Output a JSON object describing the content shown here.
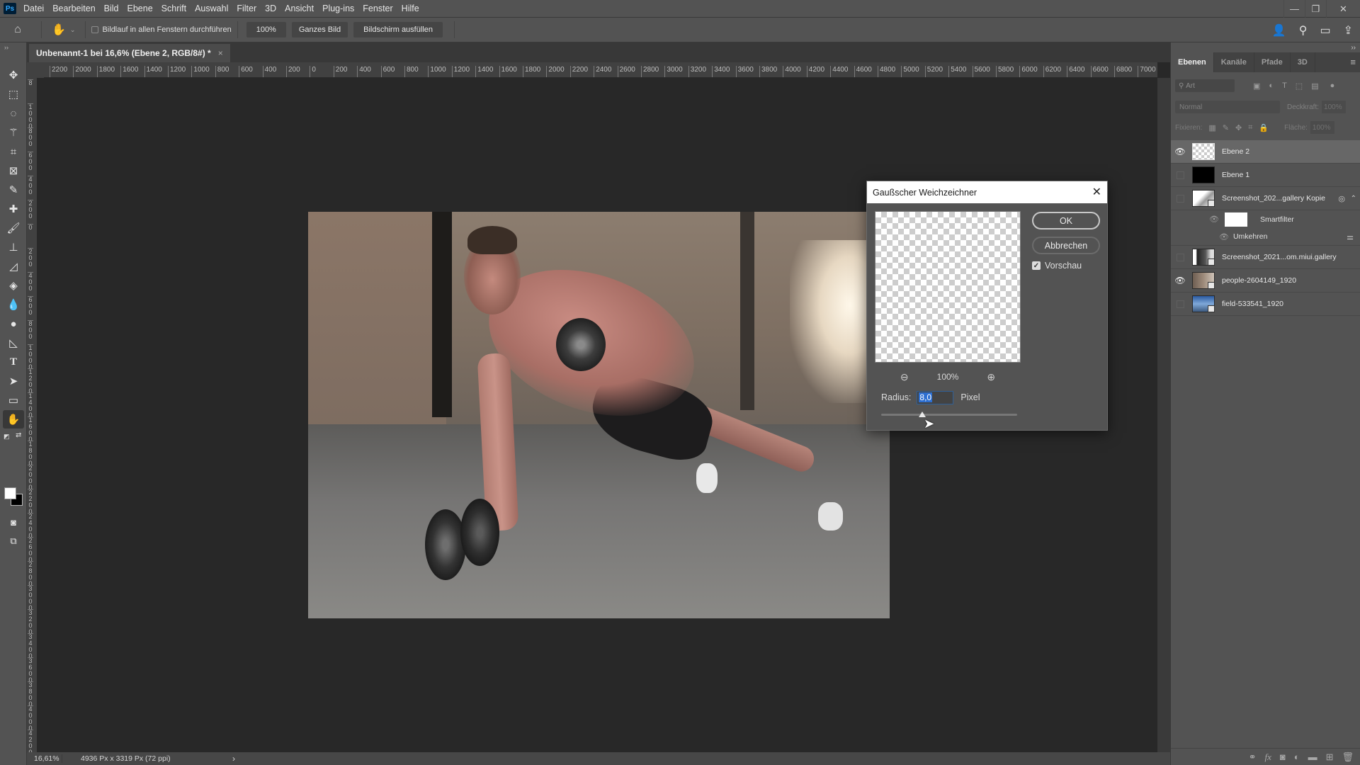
{
  "app": {
    "logo": "Ps"
  },
  "menu": [
    "Datei",
    "Bearbeiten",
    "Bild",
    "Ebene",
    "Schrift",
    "Auswahl",
    "Filter",
    "3D",
    "Ansicht",
    "Plug-ins",
    "Fenster",
    "Hilfe"
  ],
  "window_controls": {
    "minimize": "—",
    "restore": "❐",
    "close": "✕"
  },
  "options_bar": {
    "scroll_all_windows_label": "Bildlauf in allen Fenstern durchführen",
    "scroll_all_windows_checked": false,
    "zoom_100": "100%",
    "fit_screen": "Ganzes Bild",
    "fill_screen": "Bildschirm ausfüllen"
  },
  "document": {
    "tab_title": "Unbenannt-1 bei 16,6% (Ebene 2, RGB/8#) *",
    "tab_close": "×"
  },
  "rulers": {
    "horizontal": [
      "2200",
      "2000",
      "1800",
      "1600",
      "1400",
      "1200",
      "1000",
      "800",
      "600",
      "400",
      "200",
      "0",
      "200",
      "400",
      "600",
      "800",
      "1000",
      "1200",
      "1400",
      "1600",
      "1800",
      "2000",
      "2200",
      "2400",
      "2600",
      "2800",
      "3000",
      "3200",
      "3400",
      "3600",
      "3800",
      "4000",
      "4200",
      "4400",
      "4600",
      "4800",
      "5000",
      "5200",
      "5400",
      "5600",
      "5800",
      "6000",
      "6200",
      "6400",
      "6600",
      "6800",
      "7000"
    ],
    "vertical": [
      "8",
      "1000",
      "800",
      "600",
      "400",
      "200",
      "0",
      "200",
      "400",
      "600",
      "800",
      "1000",
      "1200",
      "1400",
      "1600",
      "1800",
      "2000",
      "2200",
      "2400",
      "2600",
      "2800",
      "3000",
      "3200",
      "3400",
      "3600",
      "3800",
      "4000",
      "4200"
    ]
  },
  "dialog": {
    "title": "Gaußscher Weichzeichner",
    "close": "✕",
    "ok_label": "OK",
    "cancel_label": "Abbrechen",
    "preview_label": "Vorschau",
    "preview_checked": true,
    "zoom_level": "100%",
    "radius_label": "Radius:",
    "radius_value": "8,0",
    "radius_unit": "Pixel",
    "radius_slider_fraction": 0.3
  },
  "layers_panel": {
    "tabs": [
      "Ebenen",
      "Kanäle",
      "Pfade",
      "3D"
    ],
    "active_tab": "Ebenen",
    "filter_placeholder": "Art",
    "blend_mode": "Normal",
    "opacity_label": "Deckkraft:",
    "opacity_value": "100%",
    "lock_label": "Fixieren:",
    "fill_label": "Fläche:",
    "fill_value": "100%",
    "layers": [
      {
        "name": "Ebene 2",
        "visible": true,
        "selected": true,
        "thumb": "transparent"
      },
      {
        "name": "Ebene 1",
        "visible": false,
        "selected": false,
        "thumb": "black"
      },
      {
        "name": "Screenshot_202...gallery Kopie",
        "visible": false,
        "selected": false,
        "thumb": "smart-white"
      },
      {
        "name": "Screenshot_2021...om.miui.gallery",
        "visible": false,
        "selected": false,
        "thumb": "smart-dark"
      },
      {
        "name": "people-2604149_1920",
        "visible": true,
        "selected": false,
        "thumb": "smart-photo"
      },
      {
        "name": "field-533541_1920",
        "visible": false,
        "selected": false,
        "thumb": "smart-blue"
      }
    ],
    "smart_filters_label": "Smartfilter",
    "smart_filter_item": "Umkehren"
  },
  "status": {
    "zoom": "16,61%",
    "doc_info": "4936 Px x 3319 Px (72 ppi)",
    "arrow": "›"
  }
}
